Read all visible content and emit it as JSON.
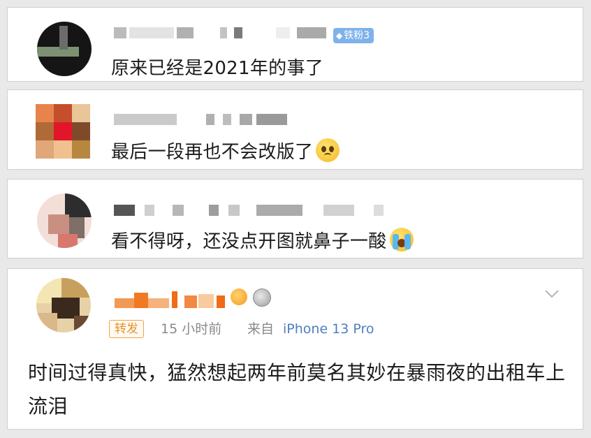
{
  "comments": [
    {
      "text": "原来已经是2021年的事了",
      "badge_label": "铁粉3",
      "badge_color": "#7fb2ea"
    },
    {
      "text": "最后一段再也不会改版了",
      "emoji_icon": "sad-face-emoji-icon"
    },
    {
      "text": "看不得呀，还没点开图就鼻子一酸",
      "emoji_icon": "crying-face-emoji-icon"
    }
  ],
  "post": {
    "repost_tag": "转发",
    "time": "15 小时前",
    "from_label": "来自",
    "device": "iPhone 13 Pro",
    "body": "时间过得真快，猛然想起两年前莫名其妙在暴雨夜的出租车上流泪",
    "menu_icon": "chevron-down-icon",
    "accent_color": "#f07a22",
    "device_color": "#4f7fbd"
  }
}
